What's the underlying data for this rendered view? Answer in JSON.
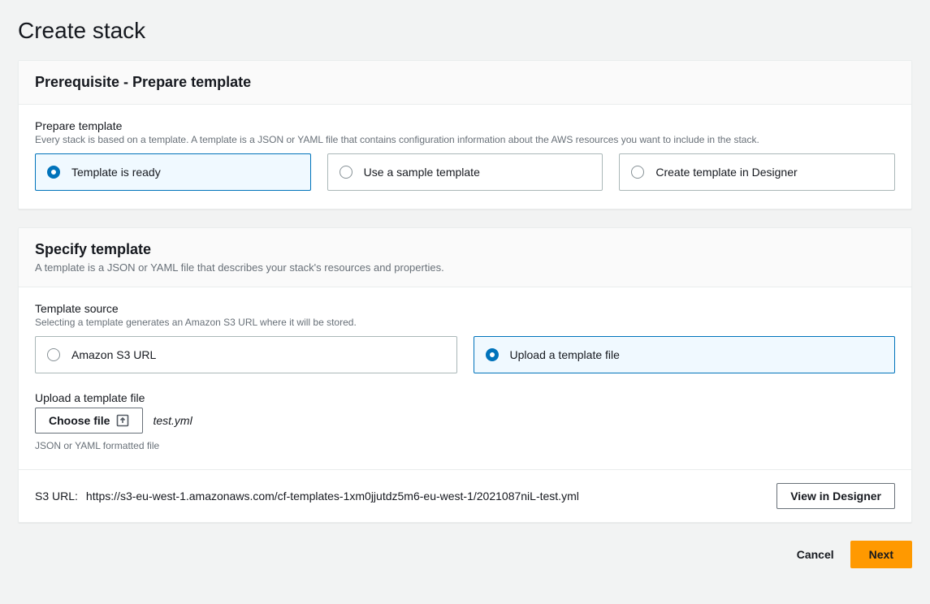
{
  "page": {
    "title": "Create stack"
  },
  "prereq": {
    "title": "Prerequisite - Prepare template",
    "field_label": "Prepare template",
    "field_help": "Every stack is based on a template. A template is a JSON or YAML file that contains configuration information about the AWS resources you want to include in the stack.",
    "options": [
      "Template is ready",
      "Use a sample template",
      "Create template in Designer"
    ],
    "selected_index": 0
  },
  "specify": {
    "title": "Specify template",
    "subtitle": "A template is a JSON or YAML file that describes your stack's resources and properties.",
    "source": {
      "label": "Template source",
      "help": "Selecting a template generates an Amazon S3 URL where it will be stored.",
      "options": [
        "Amazon S3 URL",
        "Upload a template file"
      ],
      "selected_index": 1
    },
    "upload": {
      "label": "Upload a template file",
      "button": "Choose file",
      "filename": "test.yml",
      "help": "JSON or YAML formatted file"
    },
    "s3": {
      "label": "S3 URL:",
      "url": "https://s3-eu-west-1.amazonaws.com/cf-templates-1xm0jjutdz5m6-eu-west-1/2021087niL-test.yml",
      "view_btn": "View in Designer"
    }
  },
  "footer": {
    "cancel": "Cancel",
    "next": "Next"
  }
}
